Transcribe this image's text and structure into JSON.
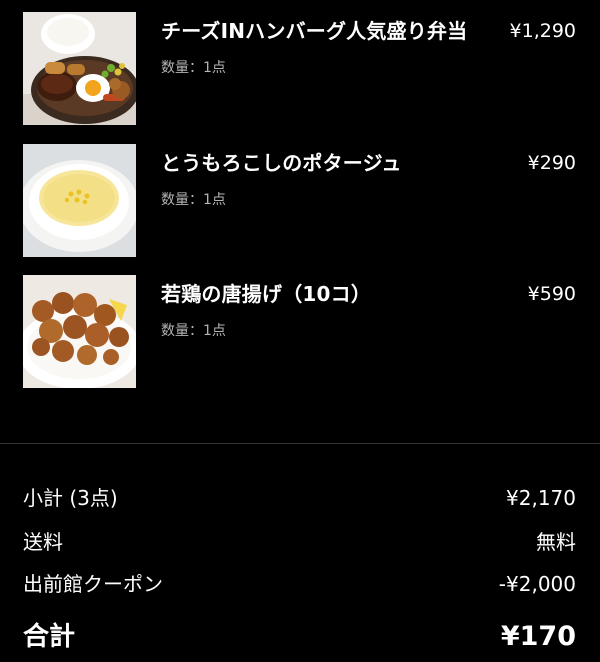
{
  "items": [
    {
      "name": "チーズINハンバーグ人気盛り弁当",
      "quantity": "数量：1点",
      "price": "¥1,290",
      "image_icon": "hamburg-bento-photo"
    },
    {
      "name": "とうもろこしのポタージュ",
      "quantity": "数量：1点",
      "price": "¥290",
      "image_icon": "corn-potage-photo"
    },
    {
      "name": "若鶏の唐揚げ（10コ）",
      "quantity": "数量：1点",
      "price": "¥590",
      "image_icon": "karaage-photo"
    }
  ],
  "summary": {
    "subtotal_label": "小計 (3点)",
    "subtotal_value": "¥2,170",
    "shipping_label": "送料",
    "shipping_value": "無料",
    "coupon_label": "出前館クーポン",
    "coupon_value": "-¥2,000",
    "total_label": "合計",
    "total_value": "¥170"
  },
  "colors": {
    "background": "#000000",
    "text": "#ffffff",
    "secondary_text": "#b4b4b4",
    "divider": "#333333"
  }
}
